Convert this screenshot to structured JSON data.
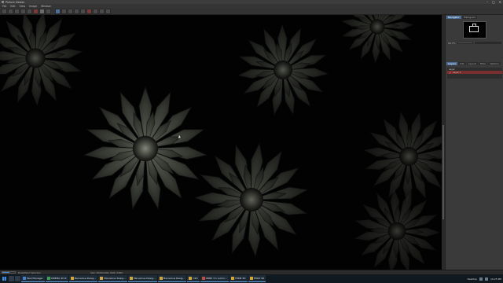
{
  "window": {
    "title": "Picture Viewer",
    "controls": [
      "–",
      "□",
      "✕"
    ]
  },
  "menu": [
    "File",
    "Edit",
    "View",
    "Image",
    "Window"
  ],
  "right_panel": {
    "tabs": [
      "Navigator",
      "Histogram"
    ],
    "zoom_label": "66.7%",
    "sub_tabs": [
      "Layers",
      "Info",
      "Layout",
      "Filter",
      "Options"
    ],
    "layer_header": "Layer",
    "layers": [
      "Layer 1"
    ]
  },
  "status": {
    "left": "Draw/Paint Selection",
    "progress": 0.55,
    "size": "Size: 3000x2000, RGB (24bit)"
  },
  "taskbar": {
    "items": [
      {
        "label": "Task Manager",
        "icon": "task-manager-icon"
      },
      {
        "label": "CINEMA 4D R",
        "icon": "cinema4d-icon"
      },
      {
        "label": "Marvelous Desig...",
        "icon": "marvelous-designer-icon"
      },
      {
        "label": "Marvelous Desig...",
        "icon": "marvelous-designer-icon"
      },
      {
        "label": "Marvelous Desig...",
        "icon": "marvelous-designer-icon"
      },
      {
        "label": "Marvelous Desig...",
        "icon": "marvelous-designer-icon"
      },
      {
        "label": "C4D",
        "icon": "folder-icon"
      },
      {
        "label": "ORBX 3.1 Lumin...",
        "icon": "orbx-icon"
      },
      {
        "label": "TERM 3D",
        "icon": "terminal-icon"
      },
      {
        "label": "TERM 3D",
        "icon": "terminal-icon"
      },
      {
        "label": "Desktop",
        "icon": "desktop-icon"
      }
    ],
    "time": "10:25 PM"
  },
  "colors": {
    "accent": "#4a6d96",
    "layer_selected": "#7a2f2f",
    "progress": "#4c8dc8"
  }
}
